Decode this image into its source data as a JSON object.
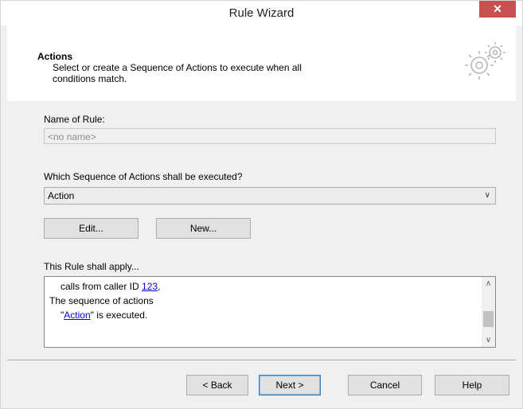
{
  "window": {
    "title": "Rule Wizard",
    "close_glyph": "✕"
  },
  "header": {
    "title": "Actions",
    "description": "Select or create a Sequence of Actions to execute when all conditions match.",
    "icon": "gears-icon"
  },
  "form": {
    "name_label": "Name of Rule:",
    "name_placeholder": "<no name>",
    "sequence_label": "Which Sequence of Actions shall be executed?",
    "sequence_selected": "Action",
    "edit_button": "Edit...",
    "new_button": "New...",
    "apply_label": "This Rule shall apply...",
    "summary": {
      "line1_prefix": "calls from caller ID ",
      "line1_link": "123",
      "line1_suffix": ",",
      "line2": "The sequence of actions",
      "line3_prefix": "\"",
      "line3_link": "Action",
      "line3_suffix": "\" is executed."
    }
  },
  "footer": {
    "back": "< Back",
    "next": "Next >",
    "cancel": "Cancel",
    "help": "Help"
  },
  "colors": {
    "close_button": "#c75050",
    "link": "#0000cc",
    "default_button_border": "#3c7fb1"
  }
}
